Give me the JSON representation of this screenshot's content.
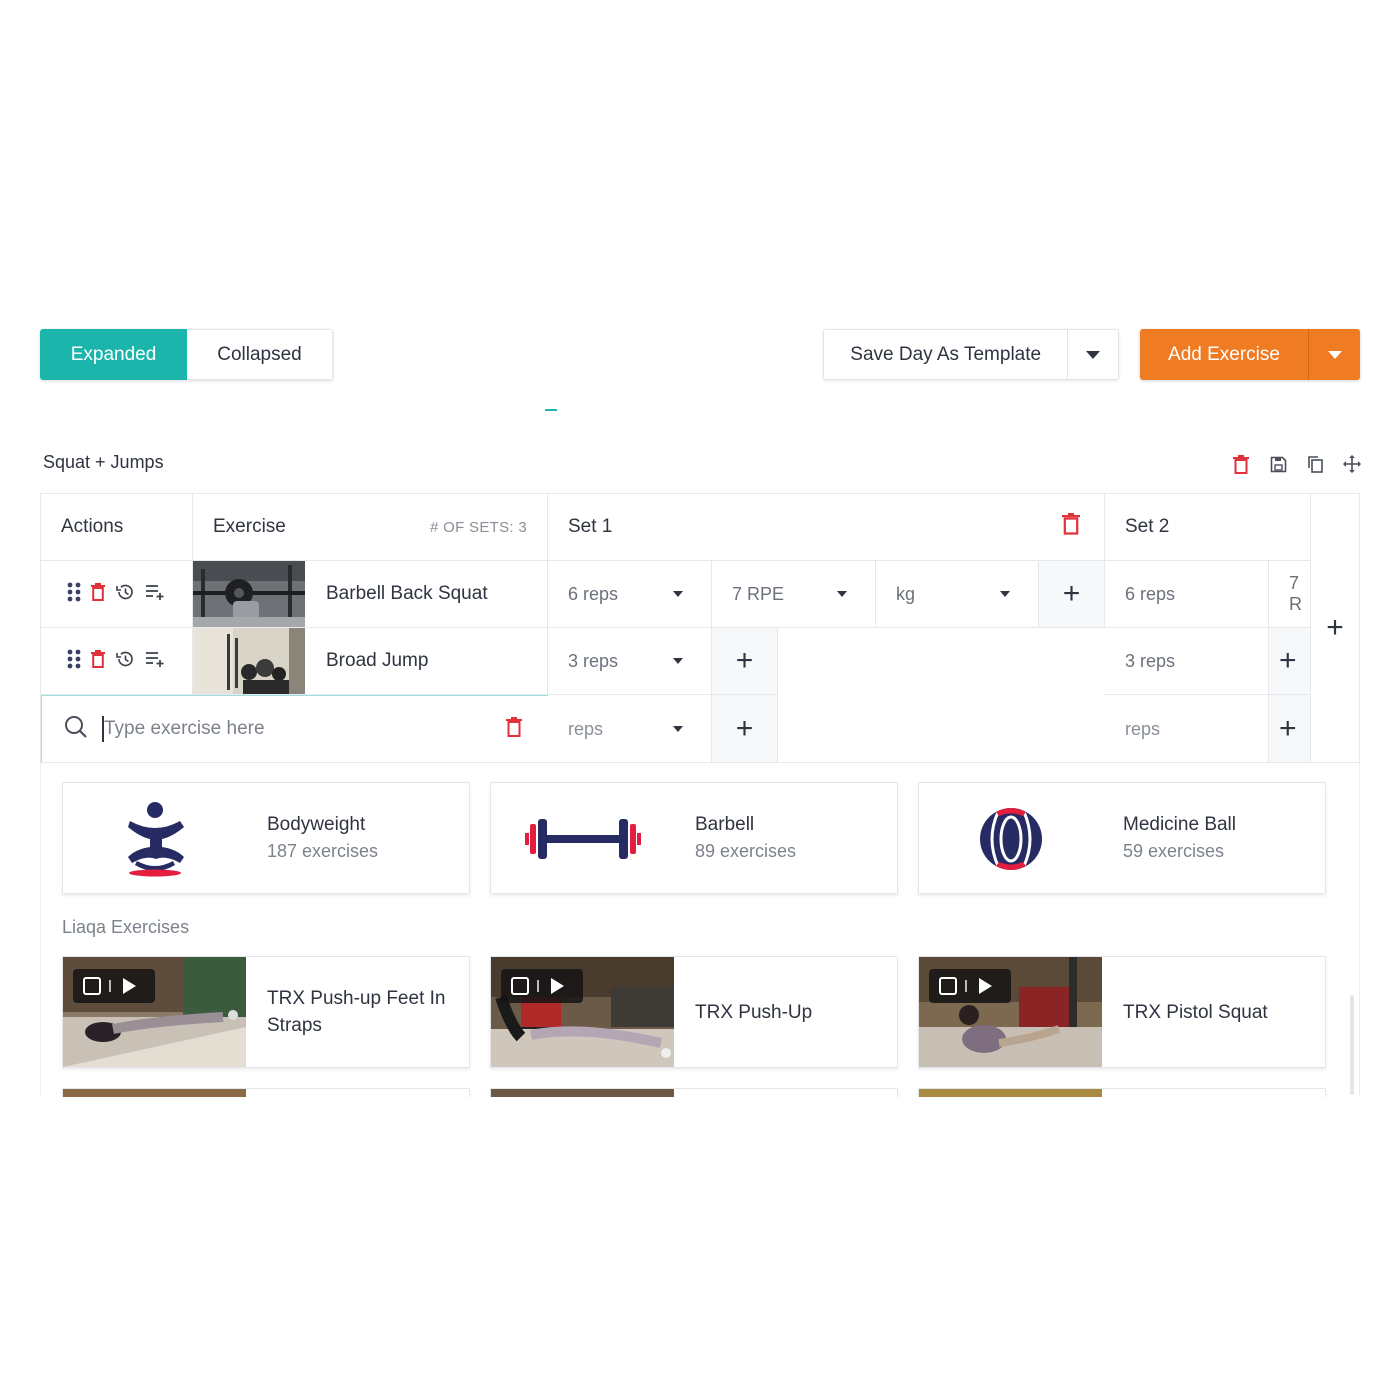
{
  "toolbar": {
    "expanded_label": "Expanded",
    "collapsed_label": "Collapsed",
    "save_template_label": "Save Day As Template",
    "add_exercise_label": "Add Exercise"
  },
  "group": {
    "title": "Squat + Jumps"
  },
  "table": {
    "headers": {
      "actions": "Actions",
      "exercise": "Exercise",
      "num_sets": "# OF SETS: 3",
      "set1": "Set 1",
      "set2": "Set 2"
    },
    "rows": [
      {
        "name": "Barbell Back Squat",
        "set1": {
          "reps": "6 reps",
          "rpe": "7 RPE",
          "unit": "kg"
        },
        "set2": {
          "reps": "6 reps",
          "rpe_partial": "7 R"
        }
      },
      {
        "name": "Broad Jump",
        "set1": {
          "reps": "3 reps"
        },
        "set2": {
          "reps": "3 reps"
        }
      }
    ],
    "new_row": {
      "search_placeholder": "Type exercise here",
      "set1_reps": "reps",
      "set2_reps": "reps"
    }
  },
  "categories": [
    {
      "name": "Bodyweight",
      "count": "187 exercises",
      "icon": "bodyweight-icon"
    },
    {
      "name": "Barbell",
      "count": "89 exercises",
      "icon": "barbell-icon"
    },
    {
      "name": "Medicine Ball",
      "count": "59 exercises",
      "icon": "medicine-ball-icon"
    }
  ],
  "section_label": "Liaqa Exercises",
  "exercises": [
    {
      "title": "TRX Push-up Feet In Straps"
    },
    {
      "title": "TRX Push-Up"
    },
    {
      "title": "TRX Pistol Squat"
    }
  ],
  "colors": {
    "accent_teal": "#1bb5ac",
    "accent_orange": "#ef7b22",
    "icon_navy": "#272b63",
    "icon_red": "#e41e3f",
    "delete_red": "#e0323c"
  }
}
